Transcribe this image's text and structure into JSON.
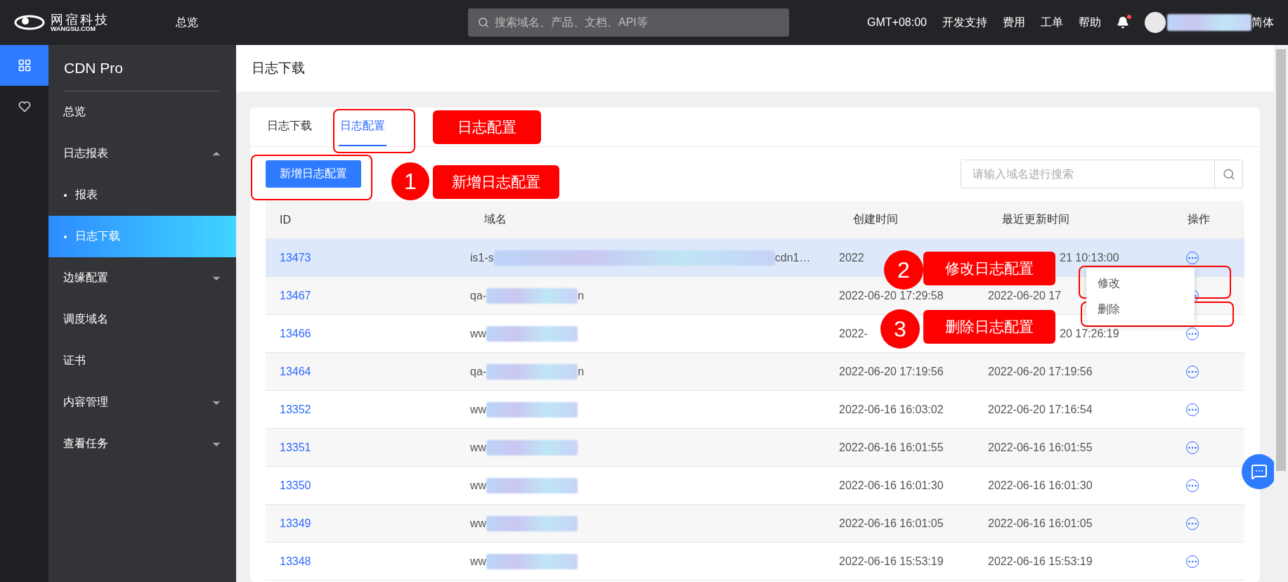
{
  "topbar": {
    "logo_cn": "网宿科技",
    "logo_en": "WANGSU.COM",
    "nav": "总览",
    "search": {
      "placeholder": "搜索域名、产品、文档、API等"
    },
    "links": [
      "GMT+08:00",
      "开发支持",
      "费用",
      "工单",
      "帮助"
    ],
    "notification": {
      "unread": true
    },
    "language": "简体"
  },
  "sidebar": {
    "title": "CDN Pro",
    "items": [
      {
        "label": "总览",
        "kind": "item",
        "selected": false
      },
      {
        "label": "日志报表",
        "kind": "group",
        "expanded": true,
        "children": [
          {
            "label": "报表",
            "kind": "sub",
            "selected": false
          },
          {
            "label": "日志下载",
            "kind": "sub",
            "selected": true
          }
        ]
      },
      {
        "label": "边缘配置",
        "kind": "group",
        "expanded": false
      },
      {
        "label": "调度域名",
        "kind": "item",
        "selected": false
      },
      {
        "label": "证书",
        "kind": "item",
        "selected": false
      },
      {
        "label": "内容管理",
        "kind": "group",
        "expanded": false
      },
      {
        "label": "查看任务",
        "kind": "group",
        "expanded": false
      }
    ]
  },
  "page_title": "日志下载",
  "tabs": [
    {
      "label": "日志下载",
      "selected": false
    },
    {
      "label": "日志配置",
      "selected": true
    }
  ],
  "add_button": "新增日志配置",
  "search": {
    "placeholder": "请输入域名进行搜索"
  },
  "table": {
    "columns": [
      "ID",
      "域名",
      "创建时间",
      "最近更新时间",
      "操作"
    ],
    "rows": [
      {
        "id": "13473",
        "domain_start": "is1-s",
        "domain_end": "cdn1…",
        "created": "2022",
        "updated": {
          "text": "21 10:13:00",
          "clipped_start": true
        },
        "highlighted": true
      },
      {
        "id": "13467",
        "domain_start": "qa-",
        "domain_end": "n",
        "created": "2022-06-20 17:29:58",
        "updated": {
          "text": "2022-06-20 17",
          "clipped_start": false
        },
        "highlighted": false
      },
      {
        "id": "13466",
        "domain_start": "ww",
        "created": "2022-",
        "updated": {
          "text": "20 17:26:19",
          "clipped_start": true
        },
        "highlighted": false
      },
      {
        "id": "13464",
        "domain_start": "qa-",
        "domain_end": "n",
        "created": "2022-06-20 17:19:56",
        "updated": {
          "text": "2022-06-20 17:19:56",
          "clipped_start": false
        },
        "highlighted": false
      },
      {
        "id": "13352",
        "domain_start": "ww",
        "created": "2022-06-16 16:03:02",
        "updated": {
          "text": "2022-06-20 17:16:54",
          "clipped_start": false
        },
        "highlighted": false
      },
      {
        "id": "13351",
        "domain_start": "ww",
        "created": "2022-06-16 16:01:55",
        "updated": {
          "text": "2022-06-16 16:01:55",
          "clipped_start": false
        },
        "highlighted": false
      },
      {
        "id": "13350",
        "domain_start": "ww",
        "created": "2022-06-16 16:01:30",
        "updated": {
          "text": "2022-06-16 16:01:30",
          "clipped_start": false
        },
        "highlighted": false
      },
      {
        "id": "13349",
        "domain_start": "ww",
        "created": "2022-06-16 16:01:05",
        "updated": {
          "text": "2022-06-16 16:01:05",
          "clipped_start": false
        },
        "highlighted": false
      },
      {
        "id": "13348",
        "domain_start": "ww",
        "created": "2022-06-16 15:53:19",
        "updated": {
          "text": "2022-06-16 15:53:19",
          "clipped_start": false
        },
        "highlighted": false
      }
    ]
  },
  "row_menu": [
    "修改",
    "删除"
  ],
  "annotations": [
    {
      "kind": "label",
      "text": "日志配置"
    },
    {
      "kind": "marker",
      "text": "1"
    },
    {
      "kind": "label",
      "text": "新增日志配置"
    },
    {
      "kind": "marker",
      "text": "2"
    },
    {
      "kind": "label",
      "text": "修改日志配置"
    },
    {
      "kind": "marker",
      "text": "3"
    },
    {
      "kind": "label",
      "text": "删除日志配置"
    }
  ]
}
